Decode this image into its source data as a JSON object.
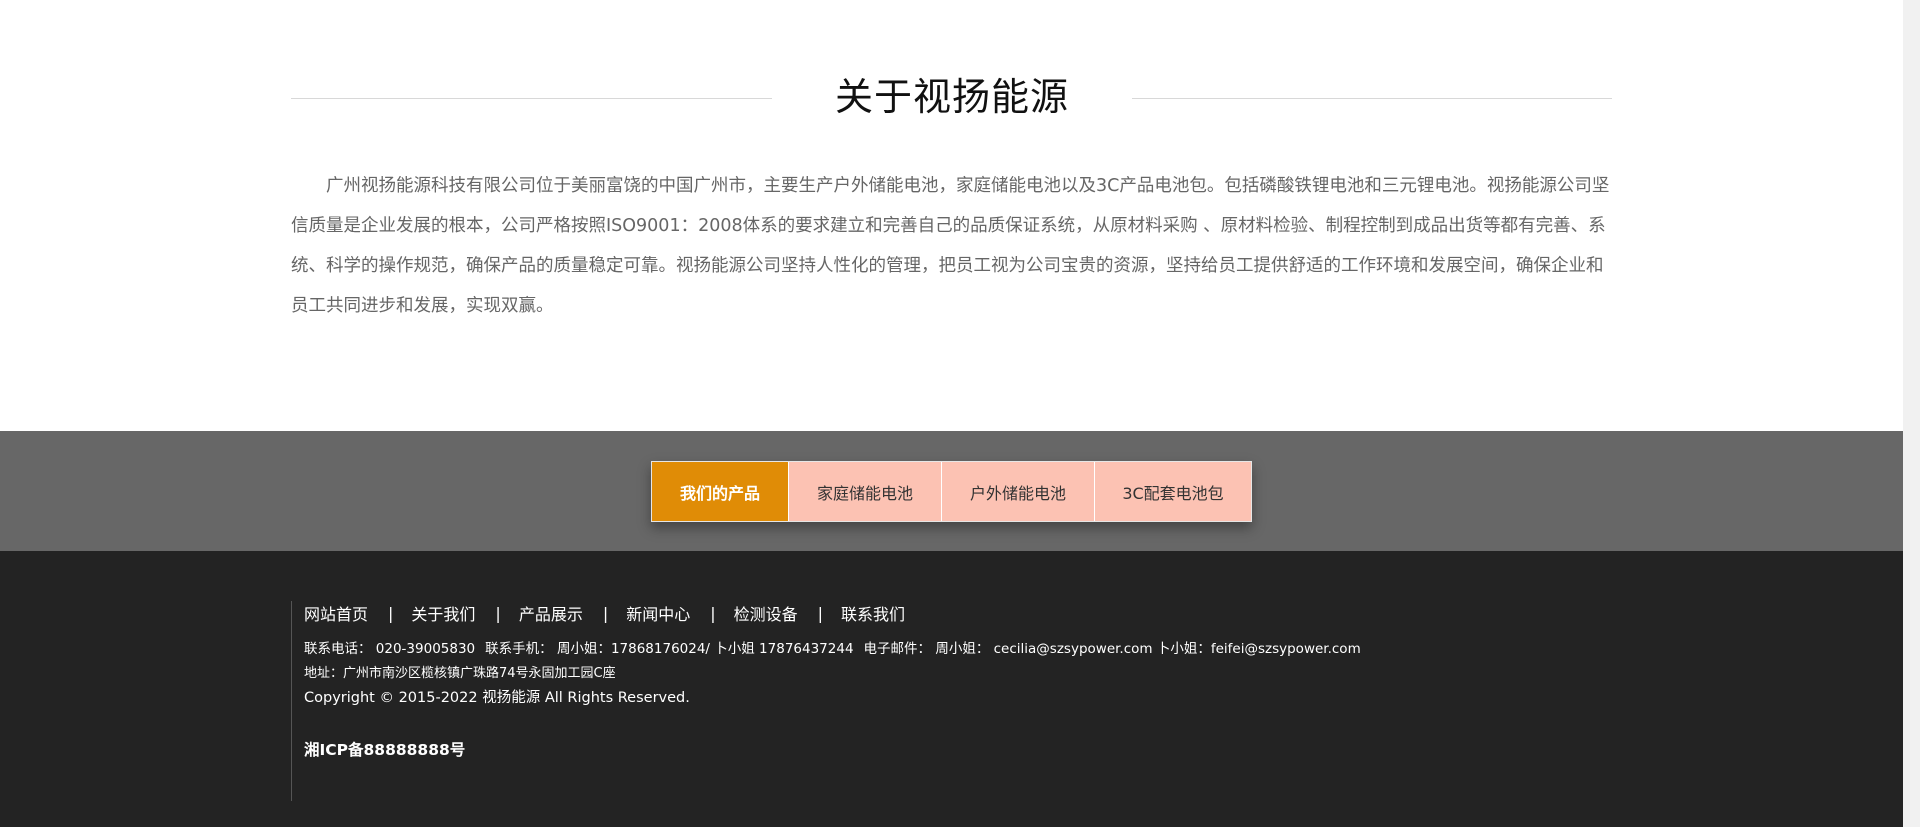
{
  "about": {
    "title": "关于视扬能源",
    "text": "广州视扬能源科技有限公司位于美丽富饶的中国广州市，主要生产户外储能电池，家庭储能电池以及3C产品电池包。包括磷酸铁锂电池和三元锂电池。视扬能源公司坚信质量是企业发展的根本，公司严格按照ISO9001：2008体系的要求建立和完善自己的品质保证系统，从原材料采购 、原材料检验、制程控制到成品出货等都有完善、系统、科学的操作规范，确保产品的质量稳定可靠。视扬能源公司坚持人性化的管理，把员工视为公司宝贵的资源，坚持给员工提供舒适的工作环境和发展空间，确保企业和员工共同进步和发展，实现双赢。"
  },
  "products": {
    "tabs": [
      {
        "label": "我们的产品",
        "active": true
      },
      {
        "label": "家庭储能电池",
        "active": false
      },
      {
        "label": "户外储能电池",
        "active": false
      },
      {
        "label": "3C配套电池包",
        "active": false
      }
    ]
  },
  "footer": {
    "nav": [
      "网站首页",
      "关于我们",
      "产品展示",
      "新闻中心",
      "检测设备",
      "联系我们"
    ],
    "separator": "|",
    "contact_phone": "联系电话： 020-39005830",
    "contact_mobile": "联系手机： 周小姐：17868176024/ 卜小姐 17876437244",
    "contact_email": "电子邮件： 周小姐： cecilia@szsypower.com 卜小姐：feifei@szsypower.com",
    "address": "地址：广州市南沙区榄核镇广珠路74号永固加工园C座",
    "copyright": "Copyright © 2015-2022 视扬能源 All Rights Reserved.",
    "icp": "湘ICP备88888888号"
  },
  "colors": {
    "active_tab": "#e08c06",
    "inactive_tab": "#fcc2b3",
    "band": "#676767",
    "footer": "#232323"
  }
}
